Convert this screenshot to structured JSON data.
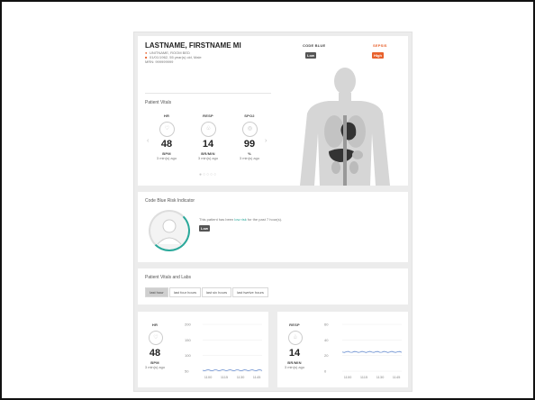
{
  "patient": {
    "name": "LASTNAME, FIRSTNAME MI",
    "location": "UNITNAME, ROOM BED",
    "demographics": "01/01/1962, 55 year(s) old, Male",
    "mrn": "MRN: 999999999"
  },
  "risk_indicators": {
    "code_blue": {
      "label": "CODE BLUE",
      "badge": "Low",
      "color": "#555555"
    },
    "sepsis": {
      "label": "SEPSIS",
      "badge": "High",
      "color": "#e8612c"
    }
  },
  "vitals": {
    "title": "Patient Vitals",
    "items": [
      {
        "label": "HR",
        "value": "48",
        "unit": "BPM",
        "time": "3 min(s) ago",
        "icon": "heart-icon"
      },
      {
        "label": "RESP",
        "value": "14",
        "unit": "BR/MIN",
        "time": "3 min(s) ago",
        "icon": "lungs-icon"
      },
      {
        "label": "SPO2",
        "value": "99",
        "unit": "%",
        "time": "3 min(s) ago",
        "icon": "oxygen-icon"
      }
    ]
  },
  "risk_card": {
    "title": "Code Blue Risk Indicator",
    "text_before": "This patient has been ",
    "text_highlight": "low risk",
    "text_after": " for the past 7 hour(s).",
    "badge": "Low",
    "accent": "#2aa89a"
  },
  "labs": {
    "title": "Patient Vitals and Labs",
    "tabs": [
      "last hour",
      "last four hours",
      "last six hours",
      "last twelve hours"
    ],
    "active_tab": 0
  },
  "charts": [
    {
      "label": "HR",
      "value": "48",
      "unit": "BPM",
      "time": "3 min(s) ago",
      "icon": "heart-icon",
      "chart_data": {
        "type": "line",
        "y_ticks": [
          "200",
          "150",
          "100",
          "50"
        ],
        "x_ticks": [
          "1100",
          "1115",
          "1130",
          "1145"
        ],
        "ylim": [
          50,
          200
        ]
      }
    },
    {
      "label": "RESP",
      "value": "14",
      "unit": "BR/MIN",
      "time": "3 min(s) ago",
      "icon": "lungs-icon",
      "chart_data": {
        "type": "line",
        "y_ticks": [
          "60",
          "40",
          "20",
          "0"
        ],
        "x_ticks": [
          "1100",
          "1115",
          "1130",
          "1145"
        ],
        "ylim": [
          0,
          60
        ]
      }
    }
  ],
  "colors": {
    "link": "#2aa89a",
    "line": "#6a8fd0"
  }
}
